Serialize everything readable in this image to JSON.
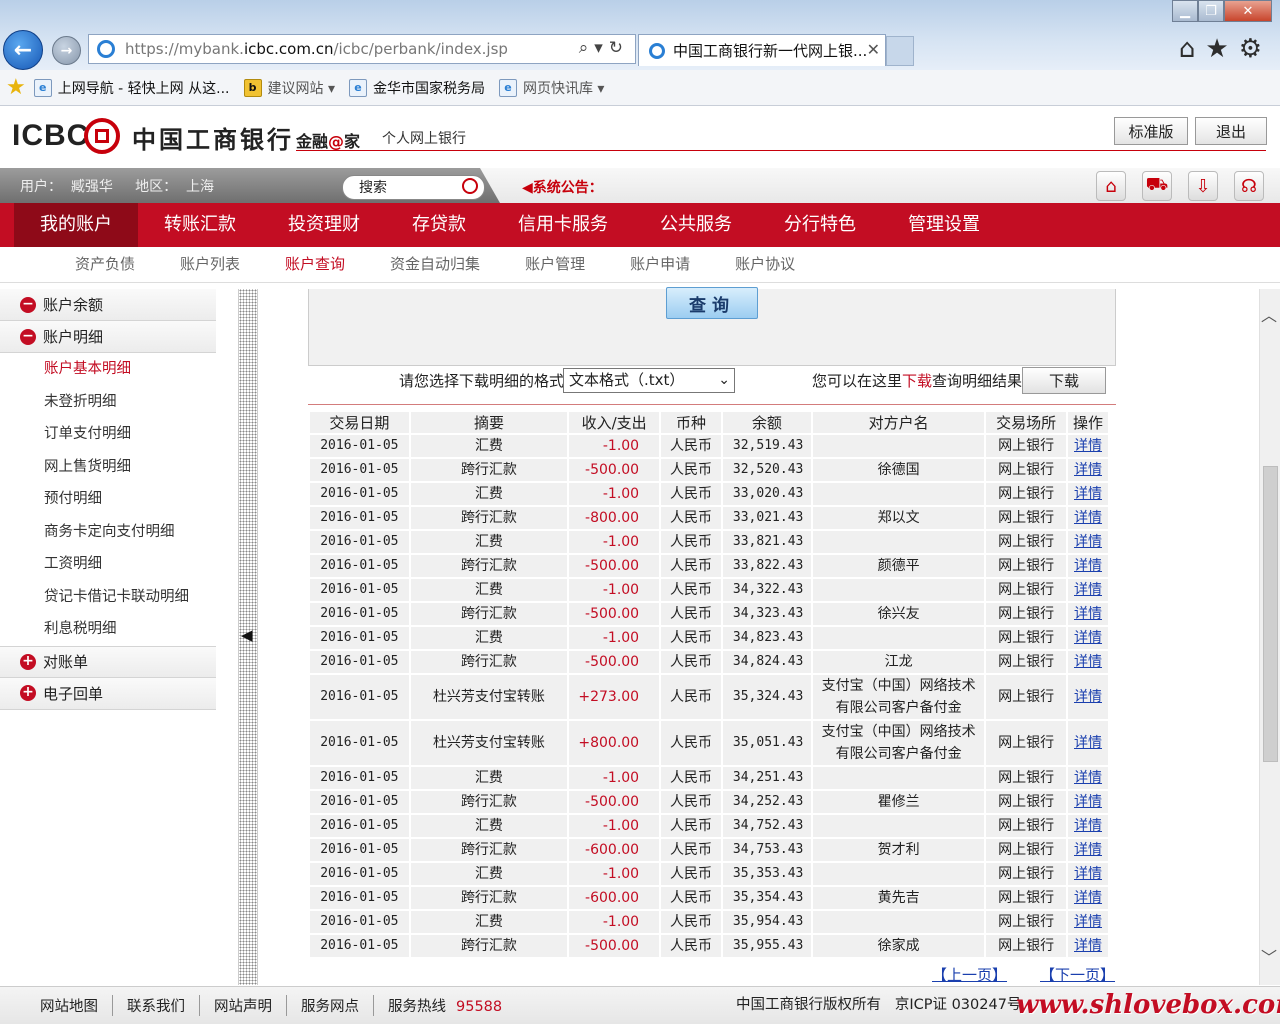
{
  "browser": {
    "url_prefix": "https://mybank.",
    "url_domain": "icbc.com.cn",
    "url_path": "/icbc/perbank/index.jsp",
    "tab_title": "中国工商银行新一代网上银...",
    "favorites": [
      {
        "label": "上网导航 - 轻快上网 从这..."
      },
      {
        "label": "建议网站 ▾"
      },
      {
        "label": "金华市国家税务局"
      },
      {
        "label": "网页快讯库 ▾"
      }
    ]
  },
  "header": {
    "logo_en": "ICBC",
    "logo_cn": "中国工商银行",
    "slogan_pre": "金融",
    "slogan_at": "@",
    "slogan_post": "家",
    "subtitle": "个人网上银行",
    "std_button": "标准版",
    "logout_button": "退出"
  },
  "userbar": {
    "user_info": "用户：  臧强华     地区：  上海",
    "search_placeholder": "搜索",
    "notice": "系统公告："
  },
  "main_nav": [
    "我的账户",
    "转账汇款",
    "投资理财",
    "存贷款",
    "信用卡服务",
    "公共服务",
    "分行特色",
    "管理设置"
  ],
  "sub_nav": [
    "资产负债",
    "账户列表",
    "账户查询",
    "资金自动归集",
    "账户管理",
    "账户申请",
    "账户协议"
  ],
  "sidebar": {
    "groups_top": [
      {
        "sign": "−",
        "label": "账户余额"
      },
      {
        "sign": "−",
        "label": "账户明细"
      }
    ],
    "items": [
      "账户基本明细",
      "未登折明细",
      "订单支付明细",
      "网上售货明细",
      "预付明细",
      "商务卡定向支付明细",
      "工资明细",
      "贷记卡借记卡联动明细",
      "利息税明细"
    ],
    "groups_bottom": [
      {
        "sign": "+",
        "label": "对账单"
      },
      {
        "sign": "+",
        "label": "电子回单"
      }
    ]
  },
  "query": {
    "button": "查询",
    "download_label": "请您选择下载明细的格式",
    "format_selected": "文本格式（.txt）",
    "hint_pre": "您可以在这里",
    "hint_link": "下载",
    "hint_post": "查询明细结果",
    "download_button": "下载"
  },
  "table": {
    "headers": [
      "交易日期",
      "摘要",
      "收入/支出",
      "币种",
      "余额",
      "对方户名",
      "交易场所",
      "操作"
    ],
    "rows": [
      [
        "2016-01-05",
        "汇费",
        "-1.00",
        "人民币",
        "32,519.43",
        "",
        "网上银行",
        "详情"
      ],
      [
        "2016-01-05",
        "跨行汇款",
        "-500.00",
        "人民币",
        "32,520.43",
        "徐德国",
        "网上银行",
        "详情"
      ],
      [
        "2016-01-05",
        "汇费",
        "-1.00",
        "人民币",
        "33,020.43",
        "",
        "网上银行",
        "详情"
      ],
      [
        "2016-01-05",
        "跨行汇款",
        "-800.00",
        "人民币",
        "33,021.43",
        "郑以文",
        "网上银行",
        "详情"
      ],
      [
        "2016-01-05",
        "汇费",
        "-1.00",
        "人民币",
        "33,821.43",
        "",
        "网上银行",
        "详情"
      ],
      [
        "2016-01-05",
        "跨行汇款",
        "-500.00",
        "人民币",
        "33,822.43",
        "颜德平",
        "网上银行",
        "详情"
      ],
      [
        "2016-01-05",
        "汇费",
        "-1.00",
        "人民币",
        "34,322.43",
        "",
        "网上银行",
        "详情"
      ],
      [
        "2016-01-05",
        "跨行汇款",
        "-500.00",
        "人民币",
        "34,323.43",
        "徐兴友",
        "网上银行",
        "详情"
      ],
      [
        "2016-01-05",
        "汇费",
        "-1.00",
        "人民币",
        "34,823.43",
        "",
        "网上银行",
        "详情"
      ],
      [
        "2016-01-05",
        "跨行汇款",
        "-500.00",
        "人民币",
        "34,824.43",
        "江龙",
        "网上银行",
        "详情"
      ],
      [
        "2016-01-05",
        "杜兴芳支付宝转账",
        "+273.00",
        "人民币",
        "35,324.43",
        "支付宝（中国）网络技术有限公司客户备付金",
        "网上银行",
        "详情"
      ],
      [
        "2016-01-05",
        "杜兴芳支付宝转账",
        "+800.00",
        "人民币",
        "35,051.43",
        "支付宝（中国）网络技术有限公司客户备付金",
        "网上银行",
        "详情"
      ],
      [
        "2016-01-05",
        "汇费",
        "-1.00",
        "人民币",
        "34,251.43",
        "",
        "网上银行",
        "详情"
      ],
      [
        "2016-01-05",
        "跨行汇款",
        "-500.00",
        "人民币",
        "34,252.43",
        "瞿修兰",
        "网上银行",
        "详情"
      ],
      [
        "2016-01-05",
        "汇费",
        "-1.00",
        "人民币",
        "34,752.43",
        "",
        "网上银行",
        "详情"
      ],
      [
        "2016-01-05",
        "跨行汇款",
        "-600.00",
        "人民币",
        "34,753.43",
        "贺才利",
        "网上银行",
        "详情"
      ],
      [
        "2016-01-05",
        "汇费",
        "-1.00",
        "人民币",
        "35,353.43",
        "",
        "网上银行",
        "详情"
      ],
      [
        "2016-01-05",
        "跨行汇款",
        "-600.00",
        "人民币",
        "35,354.43",
        "黄先吉",
        "网上银行",
        "详情"
      ],
      [
        "2016-01-05",
        "汇费",
        "-1.00",
        "人民币",
        "35,954.43",
        "",
        "网上银行",
        "详情"
      ],
      [
        "2016-01-05",
        "跨行汇款",
        "-500.00",
        "人民币",
        "35,955.43",
        "徐家成",
        "网上银行",
        "详情"
      ]
    ]
  },
  "pager": {
    "prev": "【上一页】",
    "next": "【下一页】"
  },
  "footer": {
    "links": [
      "网站地图",
      "联系我们",
      "网站声明",
      "服务网点"
    ],
    "hotline_label": "服务热线",
    "hotline": "95588",
    "copyright": "中国工商银行版权所有   京ICP证 030247号",
    "watermark": "www.shlovebox.com"
  },
  "colors": {
    "brand_red": "#c30d23",
    "nav_active": "#8e0a18",
    "link_blue": "#1a3fae"
  }
}
